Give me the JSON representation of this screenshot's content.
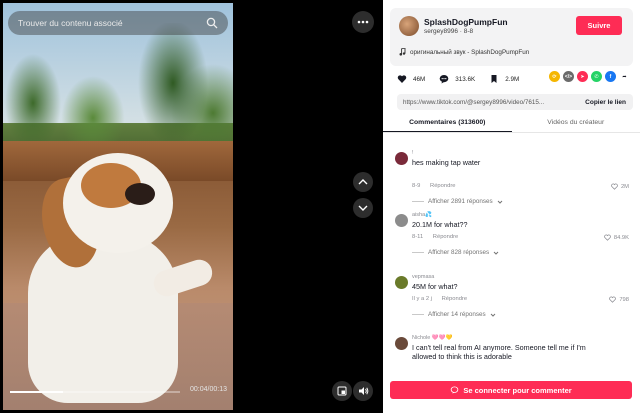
{
  "search": {
    "placeholder": "Trouver du contenu associé"
  },
  "player": {
    "time": "00:04/00:13",
    "progress": 0.31
  },
  "creator": {
    "name": "SplashDogPumpFun",
    "handle_date": "sergey8996 · 8-8",
    "follow_label": "Suivre",
    "sound": "оригинальный звук - SplashDogPumpFun"
  },
  "stats": {
    "likes": "46M",
    "comments": "313.6K",
    "saves": "2.9M"
  },
  "share": {
    "icons": [
      {
        "name": "repost-icon",
        "color": "#f5b600",
        "glyph": "⟳"
      },
      {
        "name": "embed-icon",
        "color": "#6b6b6b",
        "glyph": "</>"
      },
      {
        "name": "send-icon",
        "color": "#fe2c55",
        "glyph": "➤"
      },
      {
        "name": "whatsapp-icon",
        "color": "#25d366",
        "glyph": "✆"
      },
      {
        "name": "facebook-icon",
        "color": "#1877f2",
        "glyph": "f"
      },
      {
        "name": "forward-icon",
        "color": "#ffffff",
        "glyph": "➦"
      }
    ]
  },
  "link": {
    "url": "https://www.tiktok.com/@sergey8996/video/7615...",
    "copy_label": "Copier le lien"
  },
  "tabs": [
    {
      "label": "Commentaires (313600)",
      "active": true
    },
    {
      "label": "Vidéos du créateur",
      "active": false
    }
  ],
  "comments": [
    {
      "user": "!",
      "text": "hes making tap water",
      "date": "8-9",
      "reply": "Répondre",
      "likes": "2M",
      "replies": "Afficher 2891 réponses",
      "avatar_color": "#7a2a3a"
    },
    {
      "user": "aisha💦",
      "text": "20.1M for what??",
      "date": "8-11",
      "reply": "Répondre",
      "likes": "84.9K",
      "replies": "Afficher 828 réponses",
      "avatar_color": "#8c8c8c"
    },
    {
      "user": "vepmasa",
      "text": "45M for what?",
      "date": "Il y a 2 j",
      "reply": "Répondre",
      "likes": "798",
      "replies": "Afficher 14 réponses",
      "avatar_color": "#6a7a2a"
    },
    {
      "user": "Nichole 🩷🩷💛",
      "text": "I can't tell real from AI anymore. Someone tell me if I'm allowed to think this is adorable",
      "date": "",
      "reply": "",
      "likes": "",
      "replies": "",
      "avatar_color": "#6a4a3a"
    }
  ],
  "login": {
    "label": "Se connecter pour commenter"
  }
}
